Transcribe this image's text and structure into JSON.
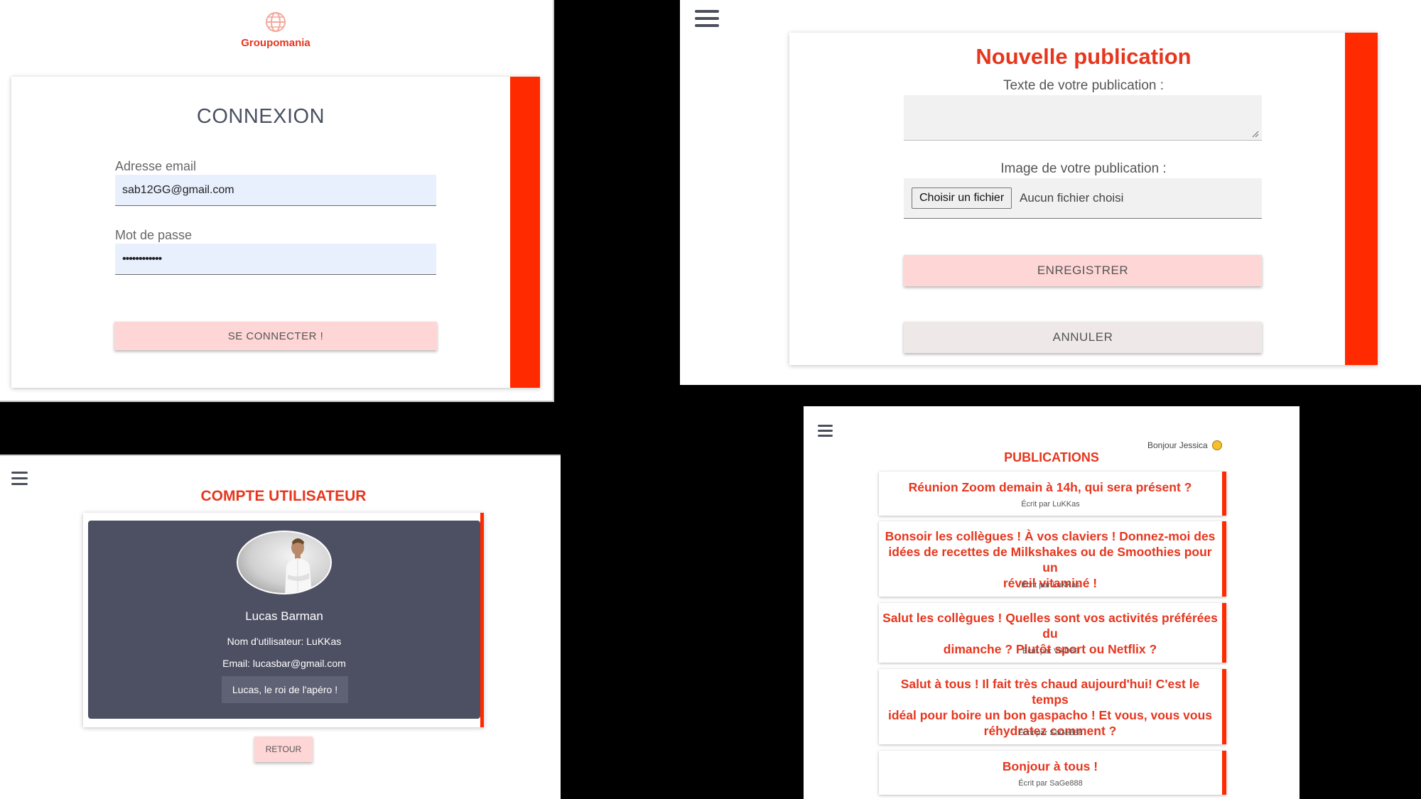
{
  "login": {
    "logo_text": "Groupomania",
    "title": "CONNEXION",
    "email_label": "Adresse email",
    "email_value": "sab12GG@gmail.com",
    "password_label": "Mot de passe",
    "password_value": "••••••••••••",
    "submit_label": "SE CONNECTER !"
  },
  "new_post": {
    "title": "Nouvelle publication",
    "text_label": "Texte de votre publication :",
    "image_label": "Image de votre publication :",
    "file_button": "Choisir un fichier",
    "file_status": "Aucun fichier choisi",
    "save_label": "ENREGISTRER",
    "cancel_label": "ANNULER"
  },
  "account": {
    "title": "COMPTE UTILISATEUR",
    "name": "Lucas Barman",
    "username_line": "Nom d'utilisateur: LuKKas",
    "email_line": "Email: lucasbar@gmail.com",
    "bio": "Lucas, le roi de l'apéro !",
    "back_label": "RETOUR"
  },
  "publications": {
    "greeting": "Bonjour Jessica",
    "title": "PUBLICATIONS",
    "posts": [
      {
        "lines": [
          "Réunion Zoom demain à 14h, qui sera présent ?"
        ],
        "author": "Écrit par LuKKas"
      },
      {
        "lines": [
          "Bonsoir les collègues ! À vos claviers ! Donnez-moi des",
          "idées de recettes de Milkshakes ou de Smoothies pour un",
          "réveil vitaminé !"
        ],
        "author": "Écrit par LuKKas"
      },
      {
        "lines": [
          "Salut les collègues ! Quelles sont vos activités préférées du",
          "dimanche ? Plutôt sport ou Netflix ?"
        ],
        "author": "Écrit par VikD89"
      },
      {
        "lines": [
          "Salut à tous ! Il fait très chaud aujourd'hui! C'est le temps",
          "idéal pour boire un bon gaspacho ! Et vous, vous vous",
          "réhydratez comment ?"
        ],
        "author": "Écrit par SaGe888"
      },
      {
        "lines": [
          "Bonjour à tous !"
        ],
        "author": "Écrit par SaGe888"
      }
    ]
  }
}
